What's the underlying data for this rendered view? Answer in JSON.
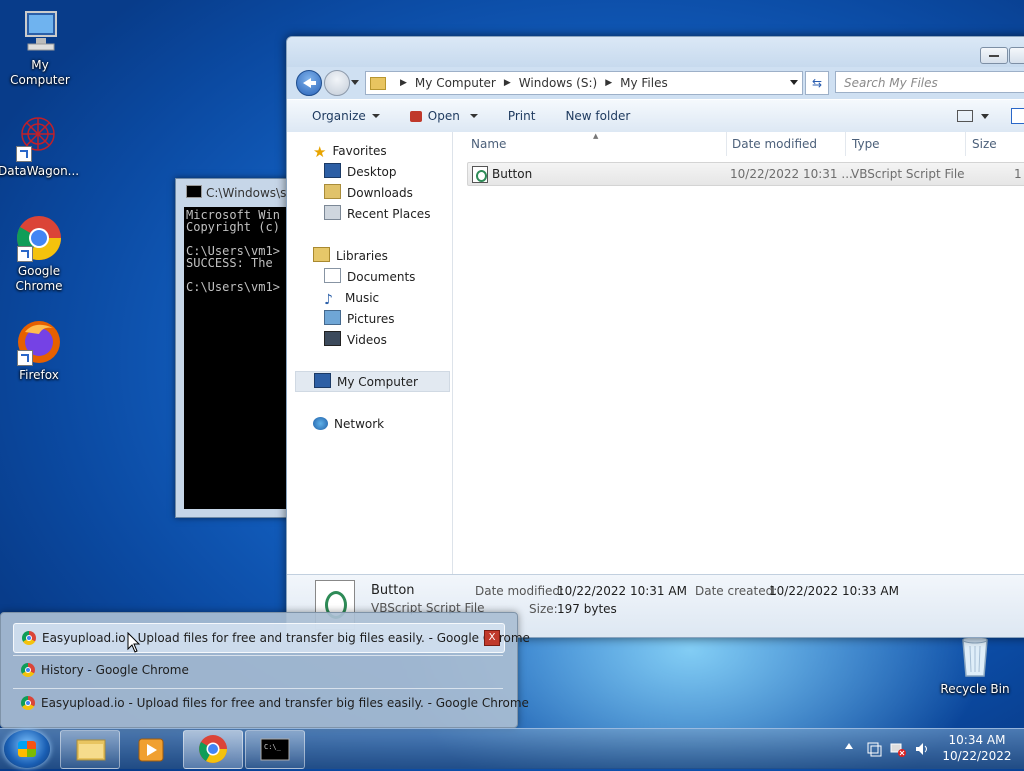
{
  "desktop": {
    "icons": [
      {
        "label": "My Computer"
      },
      {
        "label": "DataWagon..."
      },
      {
        "label": "Google Chrome"
      },
      {
        "label": "Firefox"
      },
      {
        "label": "Recycle Bin"
      }
    ]
  },
  "cmd": {
    "title": "C:\\Windows\\sy",
    "lines": "Microsoft Win\nCopyright (c)\n\nC:\\Users\\vm1>\nSUCCESS: The \n\nC:\\Users\\vm1>"
  },
  "explorer": {
    "address": [
      "My Computer",
      "Windows (S:)",
      "My Files"
    ],
    "search_placeholder": "Search My Files",
    "toolbar": {
      "organize": "Organize",
      "open": "Open",
      "print": "Print",
      "new_folder": "New folder"
    },
    "nav": {
      "favorites": "Favorites",
      "desktop": "Desktop",
      "downloads": "Downloads",
      "recent": "Recent Places",
      "libraries": "Libraries",
      "documents": "Documents",
      "music": "Music",
      "pictures": "Pictures",
      "videos": "Videos",
      "computer": "My Computer",
      "network": "Network"
    },
    "columns": {
      "name": "Name",
      "date": "Date modified",
      "type": "Type",
      "size": "Size"
    },
    "files": [
      {
        "name": "Button",
        "date": "10/22/2022 10:31 ...",
        "type": "VBScript Script File",
        "size": "1"
      }
    ],
    "details": {
      "name": "Button",
      "type": "VBScript Script File",
      "modified_label": "Date modified:",
      "modified": "10/22/2022 10:31 AM",
      "created_label": "Date created:",
      "created": "10/22/2022 10:33 AM",
      "size_label": "Size:",
      "size": "197 bytes"
    }
  },
  "thumbnails": [
    {
      "title": "Easyupload.io - Upload files for free and transfer big files easily. - Google Chrome"
    },
    {
      "title": "History - Google Chrome"
    },
    {
      "title": "Easyupload.io - Upload files for free and transfer big files easily. - Google Chrome"
    }
  ],
  "taskbar": {
    "time": "10:34 AM",
    "date": "10/22/2022"
  }
}
